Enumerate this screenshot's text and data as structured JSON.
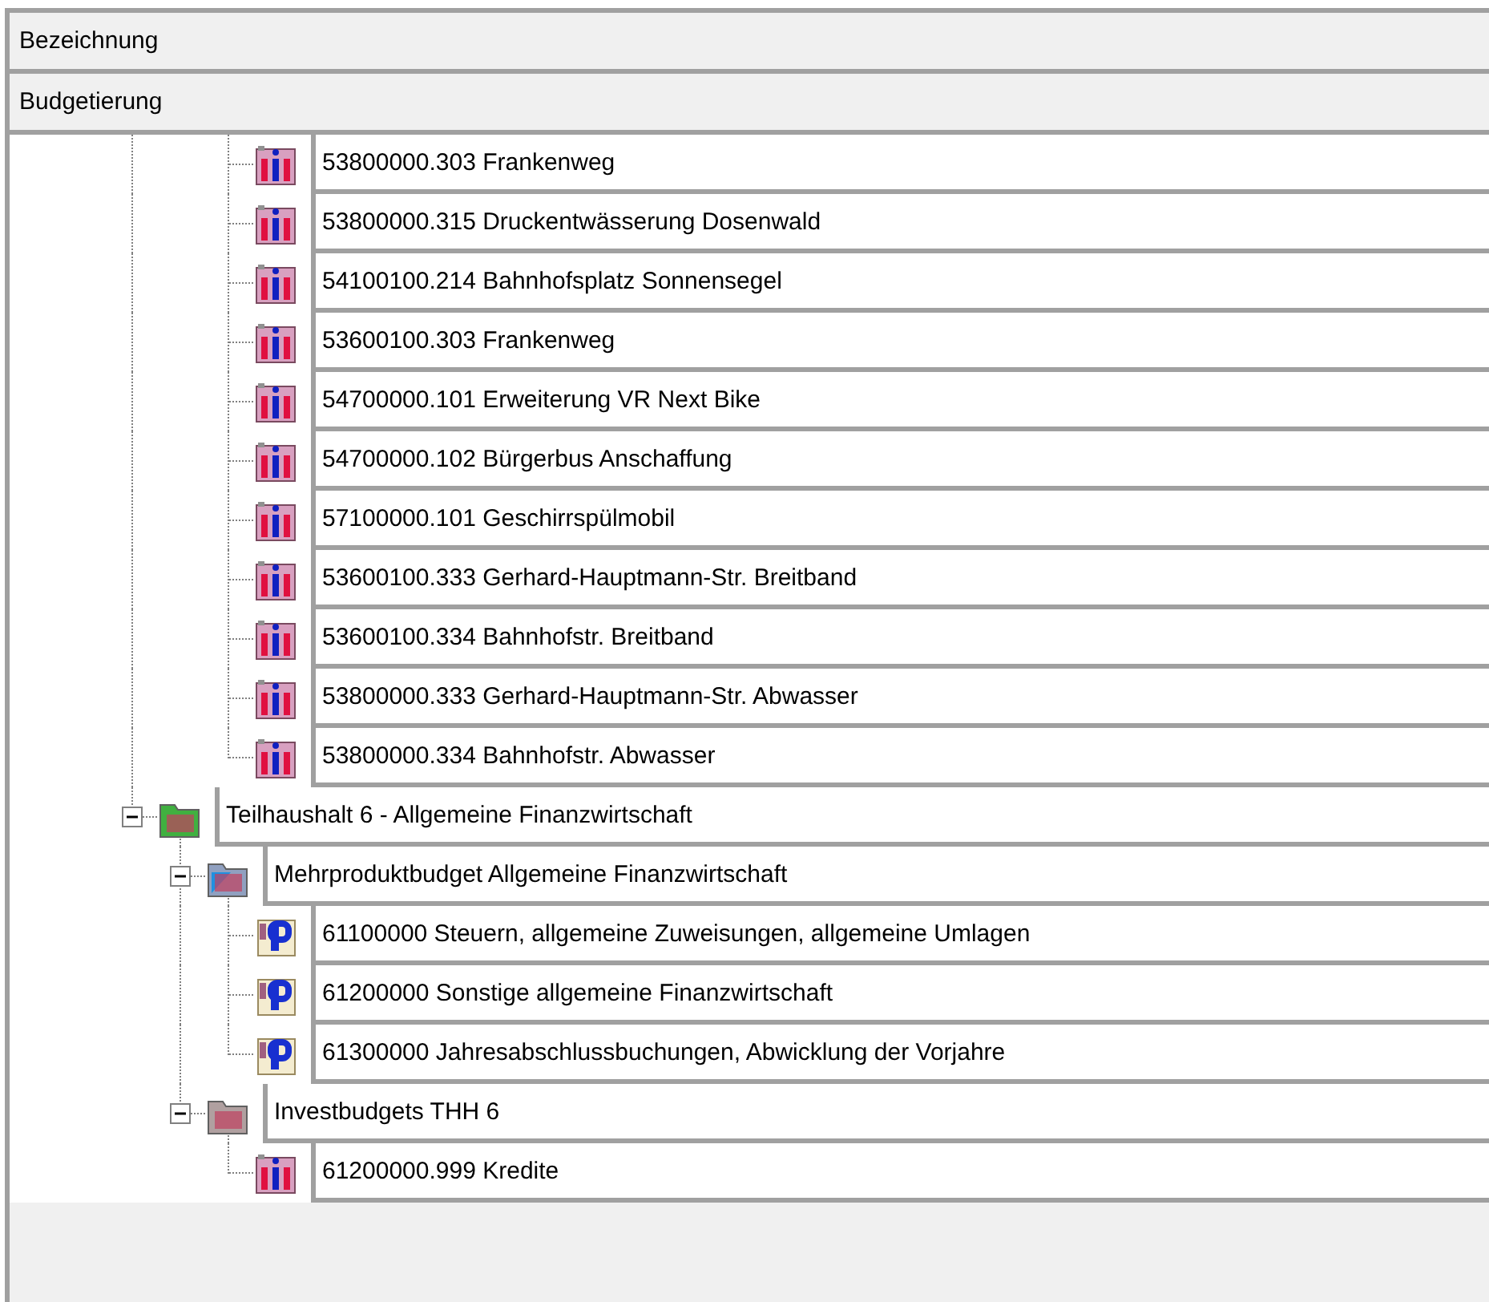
{
  "header_rows": [
    "Bezeichnung",
    "Budgetierung"
  ],
  "continued_items": [
    {
      "label": "53800000.303 Frankenweg",
      "kind": "invest"
    },
    {
      "label": "53800000.315 Druckentwässerung Dosenwald",
      "kind": "invest"
    },
    {
      "label": "54100100.214 Bahnhofsplatz Sonnensegel",
      "kind": "invest"
    },
    {
      "label": "53600100.303 Frankenweg",
      "kind": "invest"
    },
    {
      "label": "54700000.101 Erweiterung VR Next Bike",
      "kind": "invest"
    },
    {
      "label": "54700000.102 Bürgerbus Anschaffung",
      "kind": "invest"
    },
    {
      "label": "57100000.101 Geschirrspülmobil",
      "kind": "invest"
    },
    {
      "label": "53600100.333 Gerhard-Hauptmann-Str. Breitband",
      "kind": "invest"
    },
    {
      "label": "53600100.334 Bahnhofstr. Breitband",
      "kind": "invest"
    },
    {
      "label": "53800000.333 Gerhard-Hauptmann-Str. Abwasser",
      "kind": "invest"
    },
    {
      "label": "53800000.334 Bahnhofstr. Abwasser",
      "kind": "invest"
    }
  ],
  "tree": [
    {
      "label": "Teilhaushalt 6 - Allgemeine Finanzwirtschaft",
      "kind": "teilhaushalt",
      "expanded": true,
      "children": [
        {
          "label": "Mehrproduktbudget Allgemeine Finanzwirtschaft",
          "kind": "mehrprodukt",
          "expanded": true,
          "children": [
            {
              "label": "61100000 Steuern, allgemeine Zuweisungen, allgemeine Umlagen",
              "kind": "produkt"
            },
            {
              "label": "61200000 Sonstige allgemeine Finanzwirtschaft",
              "kind": "produkt"
            },
            {
              "label": "61300000 Jahresabschlussbuchungen, Abwicklung der Vorjahre",
              "kind": "produkt"
            }
          ]
        },
        {
          "label": "Investbudgets THH 6",
          "kind": "investbudget",
          "expanded": true,
          "children": [
            {
              "label": "61200000.999 Kredite",
              "kind": "invest"
            }
          ]
        }
      ]
    }
  ]
}
